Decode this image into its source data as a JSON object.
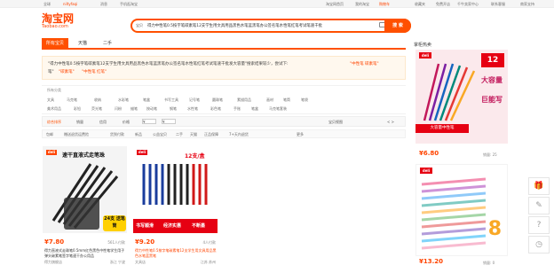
{
  "topbar": {
    "region": "全球",
    "user": "niltyfaqi",
    "messages": "消息",
    "mobile": "手机逛淘宝",
    "taobao_home": "淘宝网首页",
    "my_taobao": "我的淘宝",
    "cart": "购物车",
    "favorites": "收藏夹",
    "seller": "免费开店",
    "seller_center": "千牛卖家中心",
    "help": "联系客服",
    "merchant": "商家支持"
  },
  "logo": {
    "cn": "淘宝网",
    "en": "Taobao.com"
  },
  "search": {
    "scope": "宝贝",
    "query": "得力中性笔0.5按字笔碳素笔12支学生用文具用品黑色水笔蓝黑笔办公签名笔水性笔红笔考试笔速干批",
    "button": "搜 索"
  },
  "tabs": [
    "所有宝贝",
    "天猫",
    "二手"
  ],
  "tip": {
    "line1": "\"得力中性笔0.5按字笔碳素笔12支学生用文具用品黑色水笔蓝黑笔办公签名笔水性笔红笔考试笔速干批发大容量\"搜索结果较少，尝试下:",
    "hl1": "\"中性笔 碳素笔\"",
    "line2_pre": "笔\"",
    "hl2": "\"碳素笔\"",
    "hl3": "\"中性笔 红笔\""
  },
  "categories": {
    "label": "所有分类",
    "row1": [
      "文具",
      "马克笔",
      "收纳",
      "水彩笔",
      "笔盒",
      "书写工具",
      "记号笔",
      "圆珠笔",
      "素描用品",
      "画材",
      "笔筒",
      "笔袋"
    ],
    "row2": [
      "美术用品",
      "彩铅",
      "荧光笔",
      "闪粉",
      "蜡笔",
      "按动笔",
      "钢笔",
      "水性笔",
      "彩色笔",
      "手账",
      "笔盒",
      "马克笔套装"
    ]
  },
  "sort": {
    "items": [
      "综合排序",
      "销量",
      "信用",
      "价格"
    ],
    "price_from": "¥",
    "price_to": "¥",
    "view": "宝贝视图",
    "pager": "< >"
  },
  "filters": [
    "包邮",
    "赠送退货运费险",
    "货到付款",
    "新品",
    "公益宝贝",
    "二手",
    "天猫",
    "正品保障",
    "7+天内退货",
    "更多"
  ],
  "products": [
    {
      "banner": "速干直液式走笔珠",
      "badge": "24支 送笔筒",
      "price": "¥7.80",
      "sold": "561人付款",
      "title": "得力直液式走珠笔0.5mm红色黑色中性笔学生用子弹头碳素笔签字笔速干办公用品",
      "shop": "得力旗舰店",
      "location": "浙江 宁波"
    },
    {
      "banner": "12支/盒",
      "tags": [
        "书写顺滑",
        "经济实惠",
        "不断墨"
      ],
      "price": "¥9.20",
      "sold": "4人付款",
      "title": "得力中性笔0.5按字笔碳素笔12支学生用文具用品黑色水笔蓝黑笔",
      "shop": "文具店",
      "location": "江苏 苏州"
    }
  ],
  "sidebar": {
    "title": "掌柜热卖",
    "ad1": {
      "brand": "deli",
      "count": "12",
      "tag1": "大容量",
      "tag2": "巨能写",
      "note": "大容量中性笔",
      "price": "¥6.80",
      "sold": "销量: 25"
    },
    "ad2": {
      "brand": "deli",
      "count": "8",
      "price": "¥13.20",
      "sold": "销量: 0"
    }
  },
  "colors": {
    "accent": "#ff5000",
    "price": "#ff4400"
  }
}
